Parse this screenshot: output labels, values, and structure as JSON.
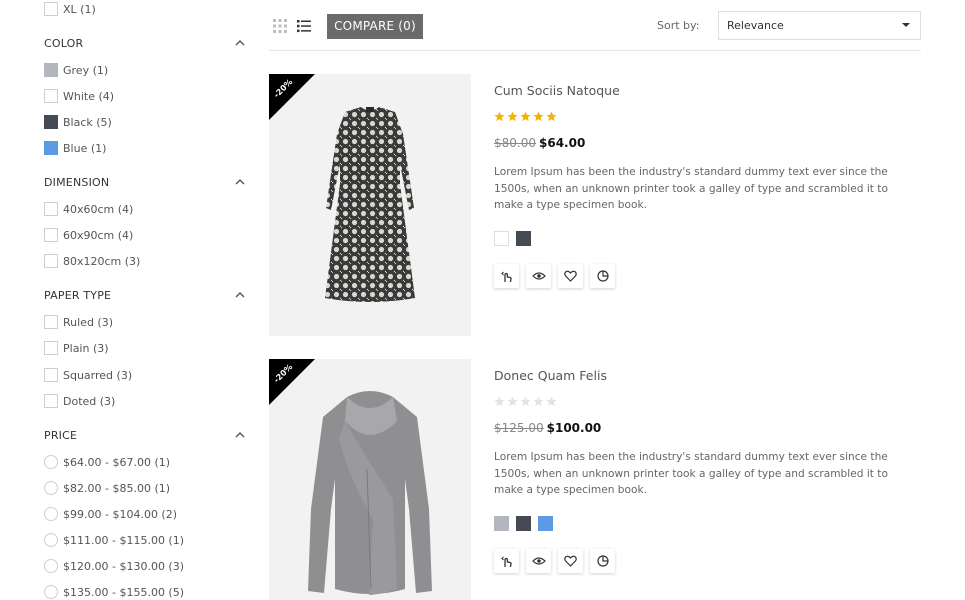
{
  "sidebar": {
    "size_items": [
      {
        "label": "XL (1)"
      }
    ],
    "color": {
      "title": "COLOR",
      "items": [
        {
          "label": "Grey (1)",
          "swatch": "#b3b6bc"
        },
        {
          "label": "White (4)",
          "swatch": "#ffffff"
        },
        {
          "label": "Black (5)",
          "swatch": "#454a55"
        },
        {
          "label": "Blue (1)",
          "swatch": "#5b9be6"
        }
      ]
    },
    "dimension": {
      "title": "DIMENSION",
      "items": [
        {
          "label": "40x60cm (4)"
        },
        {
          "label": "60x90cm (4)"
        },
        {
          "label": "80x120cm (3)"
        }
      ]
    },
    "paper_type": {
      "title": "PAPER TYPE",
      "items": [
        {
          "label": "Ruled (3)"
        },
        {
          "label": "Plain (3)"
        },
        {
          "label": "Squarred (3)"
        },
        {
          "label": "Doted (3)"
        }
      ]
    },
    "price": {
      "title": "PRICE",
      "items": [
        {
          "label": "$64.00 - $67.00 (1)"
        },
        {
          "label": "$82.00 - $85.00 (1)"
        },
        {
          "label": "$99.00 - $104.00 (2)"
        },
        {
          "label": "$111.00 - $115.00 (1)"
        },
        {
          "label": "$120.00 - $130.00 (3)"
        },
        {
          "label": "$135.00 - $155.00 (5)"
        }
      ]
    }
  },
  "toolbar": {
    "compare_label": "COMPARE (0)",
    "sort_label": "Sort by:",
    "sort_value": "Relevance",
    "icons": [
      "grid-view-icon",
      "list-view-icon"
    ]
  },
  "products": [
    {
      "name": "Cum Sociis Natoque",
      "badge": "-20%",
      "rating": 5,
      "old_price": "$80.00",
      "price": "$64.00",
      "description": "Lorem Ipsum has been the industry's standard dummy text ever since the 1500s, when an unknown printer took a galley of type and scrambled it to make a type specimen book.",
      "colors": [
        "#ffffff",
        "#454a55"
      ]
    },
    {
      "name": "Donec Quam Felis",
      "badge": "-20%",
      "rating": 0,
      "old_price": "$125.00",
      "price": "$100.00",
      "description": "Lorem Ipsum has been the industry's standard dummy text ever since the 1500s, when an unknown printer took a galley of type and scrambled it to make a type specimen book.",
      "colors": [
        "#b3b6bc",
        "#454a55",
        "#5b9be6"
      ]
    }
  ],
  "actions": [
    "add-to-cart-icon",
    "quick-view-icon",
    "wishlist-icon",
    "compare-icon"
  ],
  "colors": {
    "star_filled": "#f5b301",
    "star_empty": "#e3e3e3",
    "compare_bg": "#6b6b6b"
  }
}
